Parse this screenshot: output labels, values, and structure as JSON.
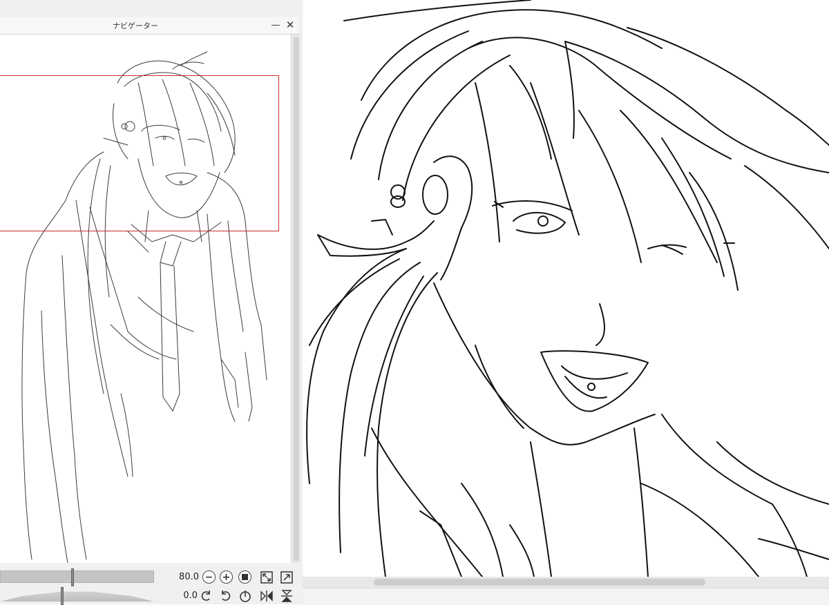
{
  "navigator": {
    "title": "ナビゲーター",
    "minimize_glyph": "—",
    "close_glyph": "✕",
    "zoom_value": "80.0",
    "rotate_value": "0.0",
    "zoom_out_glyph": "−",
    "zoom_in_glyph": "+",
    "controls": {
      "zoom_slider_fraction": 0.47,
      "rotate_slider_fraction": 0.5
    }
  },
  "icons": {
    "minimize": "minimize-icon",
    "close": "close-icon",
    "zoom_out": "zoom-out-icon",
    "zoom_in": "zoom-in-icon",
    "actual_size": "actual-size-icon",
    "fit_window": "fit-window-icon",
    "fill_window": "fill-window-icon",
    "rotate_left": "rotate-left-icon",
    "rotate_right": "rotate-right-icon",
    "reset_rotation": "reset-rotation-icon",
    "flip_horizontal": "flip-horizontal-icon",
    "flip_vertical": "flip-vertical-icon"
  },
  "colors": {
    "view_rect": "#c62a2a",
    "panel_bg": "#f0f0f0",
    "line_art": "#111111"
  }
}
